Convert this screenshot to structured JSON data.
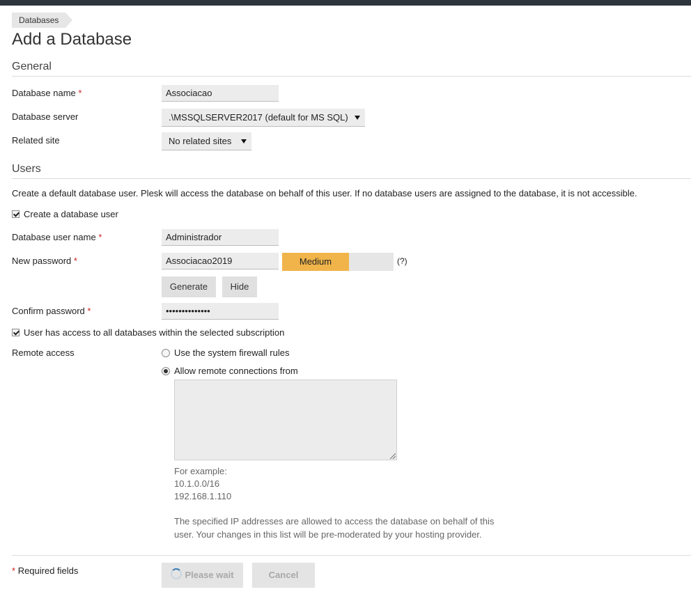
{
  "breadcrumb": {
    "label": "Databases"
  },
  "page": {
    "title": "Add a Database"
  },
  "general": {
    "heading": "General",
    "db_name_label": "Database name",
    "db_name_value": "Associacao",
    "db_server_label": "Database server",
    "db_server_value": ".\\MSSQLSERVER2017 (default for MS SQL)",
    "related_site_label": "Related site",
    "related_site_value": "No related sites"
  },
  "users": {
    "heading": "Users",
    "intro": "Create a default database user. Plesk will access the database on behalf of this user. If no database users are assigned to the database, it is not accessible.",
    "create_user_label": "Create a database user",
    "create_user_checked": true,
    "username_label": "Database user name",
    "username_value": "Administrador",
    "password_label": "New password",
    "password_value": "Associacao2019",
    "strength_label": "Medium",
    "strength_fraction": 0.6,
    "strength_color": "#f0b44a",
    "strength_help": "(?)",
    "generate_label": "Generate",
    "hide_label": "Hide",
    "confirm_label": "Confirm password",
    "confirm_value": "••••••••••••••",
    "access_all_label": "User has access to all databases within the selected subscription",
    "access_all_checked": true,
    "remote_label": "Remote access",
    "remote_option_1": "Use the system firewall rules",
    "remote_option_2": "Allow remote connections from",
    "remote_selected": 2,
    "remote_value": "",
    "example_heading": "For example:",
    "example_1": "10.1.0.0/16",
    "example_2": "192.168.1.110",
    "note_line_1": "The specified IP addresses are allowed to access the database on behalf of this",
    "note_line_2": "user. Your changes in this list will be pre-moderated by your hosting provider."
  },
  "footer": {
    "required_mark": "*",
    "required_label": "Required fields",
    "wait_label": "Please wait",
    "cancel_label": "Cancel"
  },
  "marks": {
    "required": "*"
  },
  "colors": {
    "topbar": "#2e343b",
    "required": "#cc2222",
    "accent": "#3a7ab8"
  }
}
